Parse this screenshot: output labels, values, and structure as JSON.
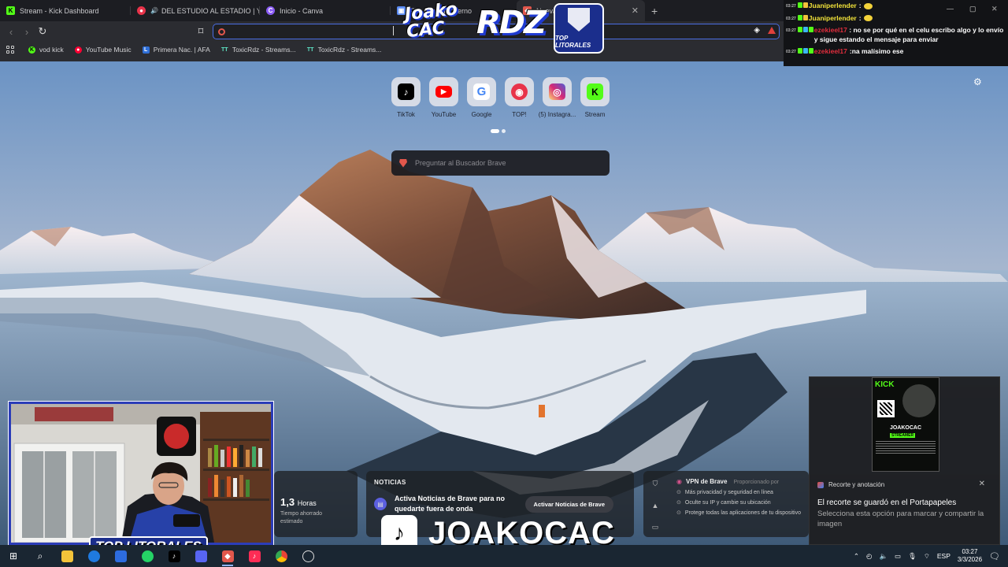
{
  "tabs": [
    {
      "label": "Stream - Kick Dashboard",
      "color": "#53fc18",
      "glyph": "K"
    },
    {
      "label": "DEL ESTUDIO AL ESTADIO | YouTu",
      "color": "#e8334a",
      "glyph": "●"
    },
    {
      "label": "Inicio - Canva",
      "color": "#8b5cf6",
      "glyph": "C"
    },
    {
      "label": "Fl... minar moderno",
      "color": "#5b8cf5",
      "glyph": "▣"
    },
    {
      "label": "Nueva pestaña",
      "color": "#e2574c",
      "glyph": "◆",
      "active": true
    }
  ],
  "bookmarks": [
    {
      "label": "vod kick",
      "color": "#53fc18",
      "glyph": "K"
    },
    {
      "label": "YouTube Music",
      "color": "#ff0033",
      "glyph": "●"
    },
    {
      "label": "Primera Nac. | AFA",
      "color": "#2f6fd8",
      "glyph": "L"
    },
    {
      "label": "ToxicRdz - Streams...",
      "color": "#5fe8c8",
      "glyph": "TT"
    },
    {
      "label": "ToxicRdz - Streams...",
      "color": "#5fe8c8",
      "glyph": "TT"
    }
  ],
  "chat": [
    {
      "time": "03:27",
      "user": "Juaniperlender",
      "user_color": "#f3e43a",
      "text": ""
    },
    {
      "time": "03:27",
      "user": "Juaniperlender",
      "user_color": "#f3e43a",
      "text": ""
    },
    {
      "time": "03:27",
      "user": "ezekieel17",
      "user_color": "#e02d3c",
      "text": "no se por qué en el celu escribo algo y lo envío y sigue estando el mensaje para enviar"
    },
    {
      "time": "03:27",
      "user": "ezekieel17",
      "user_color": "#e02d3c",
      "text": "na malísimo ese"
    }
  ],
  "topsites": [
    {
      "label": "TikTok",
      "glyph": "♪",
      "bg": "#000000",
      "fg": "#ffffff"
    },
    {
      "label": "YouTube",
      "glyph": "▶",
      "bg": "#ff0000",
      "fg": "#ffffff"
    },
    {
      "label": "Google",
      "glyph": "G",
      "bg": "#ffffff",
      "fg": "#4285f4"
    },
    {
      "label": "TOP!",
      "glyph": "◉",
      "bg": "#e8334a",
      "fg": "#ffffff"
    },
    {
      "label": "(5) Instagra...",
      "glyph": "◎",
      "bg": "#d62976",
      "fg": "#ffffff"
    },
    {
      "label": "Stream",
      "glyph": "K",
      "bg": "#53fc18",
      "fg": "#000000"
    }
  ],
  "search": {
    "placeholder": "Preguntar al Buscador Brave"
  },
  "stats": {
    "value": "1,3",
    "unit": "Horas",
    "caption": "Tiempo ahorrado estimado"
  },
  "news": {
    "header": "NOTICIAS",
    "text": "Activa Noticias de Brave para no quedarte fuera de onda",
    "button": "Activar Noticias de Brave"
  },
  "vpn": {
    "title": "VPN de Brave",
    "sponsor": "Proporcionado por",
    "items": [
      "Más privacidad y seguridad en línea",
      "Oculte su IP y cambie su ubicación",
      "Protege todas las aplicaciones de tu dispositivo"
    ]
  },
  "toast": {
    "app": "Recorte y anotación",
    "title": "El recorte se guardó en el Portapapeles",
    "body": "Selecciona esta opción para marcar y compartir la imagen",
    "thumb_brand": "KICK",
    "thumb_name": "JOAKOCAC",
    "thumb_role": "STREAMER"
  },
  "overlay": {
    "logo_left": "Joako CAC",
    "logo_mid": "RDZ",
    "logo_right": "TOP LITORALES",
    "badge": "TOP LITORALES",
    "banner_name": "JOAKOCAC"
  },
  "taskbar": {
    "lang": "ESP",
    "time": "03:27",
    "date": "3/3/2026"
  },
  "colors": {
    "accent": "#4a6de5",
    "brave_orange": "#e2574c",
    "kick_green": "#53fc18",
    "overlay_blue": "#1f3ad1"
  }
}
